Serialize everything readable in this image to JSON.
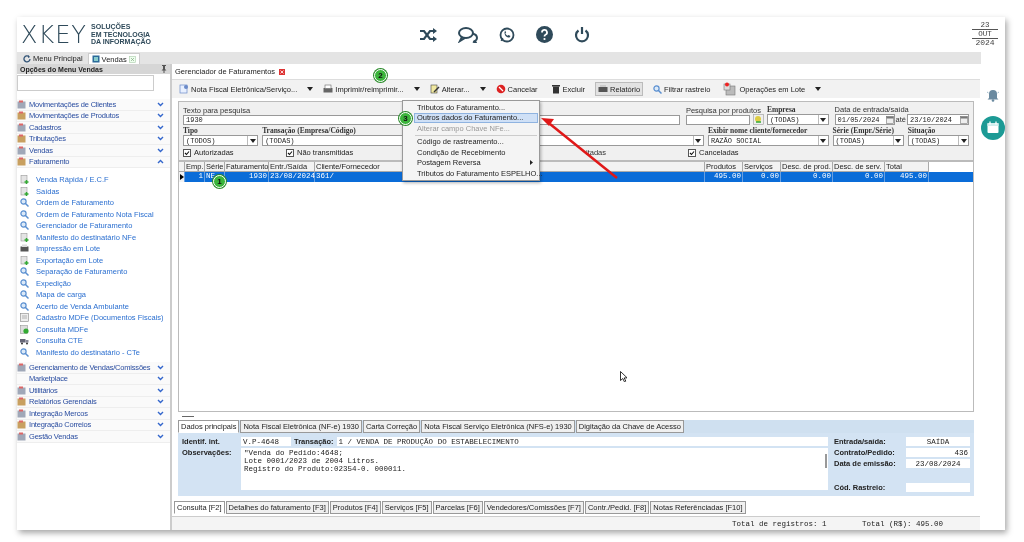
{
  "header": {
    "logo": "XKEY",
    "tagline": [
      "SOLUÇÕES",
      "EM TECNOLOGIA",
      "DA INFORMAÇÃO"
    ],
    "date": {
      "day": "23",
      "month": "OUT",
      "year": "2024"
    }
  },
  "top_tabs": [
    {
      "label": "Menu Principal",
      "selected": false
    },
    {
      "label": "Vendas",
      "selected": true
    }
  ],
  "sidebar": {
    "title": "Opções do Menu Vendas",
    "groups": [
      {
        "label": "Movimentações de Clientes",
        "kind": "icon",
        "expanded": false
      },
      {
        "label": "Movimentações de Produtos",
        "kind": "icon",
        "expanded": false
      },
      {
        "label": "Cadastros",
        "kind": "icon",
        "expanded": false
      },
      {
        "label": "Tributações",
        "kind": "icon",
        "expanded": false
      },
      {
        "label": "Vendas",
        "kind": "icon",
        "expanded": false
      },
      {
        "label": "Faturamento",
        "kind": "icon",
        "expanded": true,
        "children": [
          {
            "label": "Venda Rápida / E.C.F",
            "kind": "add"
          },
          {
            "label": "Saídas",
            "kind": "add"
          },
          {
            "label": "Ordem de Faturamento",
            "kind": "search"
          },
          {
            "label": "Ordem de Faturamento Nota Fiscal",
            "kind": "search"
          },
          {
            "label": "Gerenciador de Faturamento",
            "kind": "search"
          },
          {
            "label": "Manifesto do destinatário NFe",
            "kind": "add"
          },
          {
            "label": "Impressão em Lote",
            "kind": "print"
          },
          {
            "label": "Exportação em Lote",
            "kind": "add"
          },
          {
            "label": "Separação de Faturamento",
            "kind": "search"
          },
          {
            "label": "Expedição",
            "kind": "search"
          },
          {
            "label": "Mapa de carga",
            "kind": "search"
          },
          {
            "label": "Acerto de Venda Ambulante",
            "kind": "search"
          },
          {
            "label": "Cadastro MDFe (Documentos Fiscais)",
            "kind": "doc"
          },
          {
            "label": "Consulta MDFe",
            "kind": "globe"
          },
          {
            "label": "Consulta CTE",
            "kind": "truck"
          },
          {
            "label": "Manifesto do destinatário - CTe",
            "kind": "search"
          }
        ]
      },
      {
        "label": "Gerenciamento de Vendas/Comissões",
        "kind": "icon",
        "expanded": false
      },
      {
        "label": "Marketplace",
        "kind": "plain",
        "expanded": false
      },
      {
        "label": "Utilitários",
        "kind": "icon",
        "expanded": false
      },
      {
        "label": "Relatórios Gerenciais",
        "kind": "icon",
        "expanded": false
      },
      {
        "label": "Integração Mercos",
        "kind": "icon",
        "expanded": false
      },
      {
        "label": "Integração Correios",
        "kind": "icon",
        "expanded": false
      },
      {
        "label": "Gestão Vendas",
        "kind": "icon",
        "expanded": false
      }
    ]
  },
  "document_tab": {
    "label": "Gerenciador de Faturamentos"
  },
  "toolbar": [
    {
      "label": "Nota Fiscal Eletrônica/Serviço...",
      "kind": "nfe",
      "dropdown": true,
      "pressed": false
    },
    {
      "label": "Imprimir/reimprimir...",
      "kind": "print",
      "dropdown": true,
      "pressed": false
    },
    {
      "label": "Alterar...",
      "kind": "edit",
      "dropdown": true,
      "pressed": false
    },
    {
      "label": "Cancelar",
      "kind": "cancel",
      "dropdown": false,
      "pressed": false
    },
    {
      "label": "Excluir",
      "kind": "delete",
      "dropdown": false,
      "pressed": false
    },
    {
      "label": "Relatório",
      "kind": "report",
      "dropdown": false,
      "pressed": true
    },
    {
      "label": "Filtrar rastreio",
      "kind": "search",
      "dropdown": false,
      "pressed": false
    },
    {
      "label": "Operações em Lote",
      "kind": "batch",
      "dropdown": true,
      "pressed": false
    }
  ],
  "filters": {
    "search_label": "Texto para pesquisa",
    "search_value": "1930",
    "product_label": "Pesquisa por produtos",
    "empresa": {
      "label": "Empresa",
      "value": "(TODAS)"
    },
    "date_label": "Data de entrada/saída",
    "date_from": "01/05/2024",
    "date_sep": "até",
    "date_to": "23/10/2024",
    "tipo": {
      "label": "Tipo",
      "value": "(TODOS)"
    },
    "transacao": {
      "label": "Transação (Empresa/Código)",
      "value": "(TODAS)"
    },
    "exibir": {
      "label": "Exibir nome cliente/fornecedor",
      "value": "RAZÃO SOCIAL"
    },
    "serie": {
      "label": "Série (Empr./Série)",
      "value": "(TODAS)"
    },
    "situacao": {
      "label": "Situação",
      "value": "(TODAS)"
    },
    "checks": [
      {
        "label": "Autorizadas",
        "checked": true
      },
      {
        "label": "Não transmitidas",
        "checked": true
      }
    ],
    "partial_label": "itadas",
    "last_check": {
      "label": "Canceladas",
      "checked": true
    }
  },
  "table": {
    "columns": [
      "Emp.",
      "Série",
      "Faturamento",
      "Entr./Saída",
      "Cliente/Fornecedor",
      "Produtos",
      "Serviços",
      "Desc. de prod.",
      "Desc. de serv.",
      "Total"
    ],
    "rows": [
      {
        "selected": true,
        "cells": [
          "1",
          "NE",
          "1930",
          "23/08/2024",
          "361/",
          "495.00",
          "0.00",
          "0.00",
          "0.00",
          "495.00"
        ]
      }
    ]
  },
  "menu": [
    {
      "label": "Tributos do Faturamento...",
      "selected": false,
      "disabled": false,
      "submenu": false
    },
    {
      "label": "Outros dados do Faturamento...",
      "selected": true,
      "disabled": false,
      "submenu": false
    },
    {
      "label": "Alterar campo Chave NFe...",
      "selected": false,
      "disabled": true,
      "submenu": false
    },
    {
      "label": "Código de rastreamento...",
      "selected": false,
      "disabled": false,
      "submenu": false
    },
    {
      "label": "Condição de Recebimento",
      "selected": false,
      "disabled": false,
      "submenu": false
    },
    {
      "label": "Postagem Reversa",
      "selected": false,
      "disabled": false,
      "submenu": true
    },
    {
      "label": "Tributos do Faturamento ESPELHO...",
      "selected": false,
      "disabled": false,
      "submenu": false
    }
  ],
  "annotations": [
    "1",
    "2",
    "3"
  ],
  "detail_tabs": [
    {
      "label": "Dados principais",
      "selected": true
    },
    {
      "label": "Nota Fiscal Eletrônica (NF-e) 1930",
      "selected": false
    },
    {
      "label": "Carta Correção",
      "selected": false
    },
    {
      "label": "Nota Fiscal Serviço Eletrônica (NFS-e) 1930",
      "selected": false
    },
    {
      "label": "Digitação da Chave de Acesso",
      "selected": false
    }
  ],
  "details": {
    "ident_label": "Identif. int.",
    "ident": "V.P-4648",
    "transacao_label": "Transação:",
    "transacao": "1 / VENDA DE PRODUÇÃO DO ESTABELECIMENTO",
    "obs_label": "Observações:",
    "obs": [
      "\"Venda do Pedido:4648;",
      "Lote 0001/2023 de 2004 Litros.",
      "Registro do Produto:02354-0. 000011."
    ],
    "side": [
      {
        "label": "Entrada/saída:",
        "value": "SAÍDA"
      },
      {
        "label": "Contrato/Pedido:",
        "value": "436"
      },
      {
        "label": "Data de emissão:",
        "value": "23/08/2024"
      },
      {
        "label": "Cód. Rastreio:"
      }
    ]
  },
  "bottom_tabs": [
    {
      "label": "Consulta [F2]",
      "selected": true
    },
    {
      "label": "Detalhes do faturamento [F3]",
      "selected": false
    },
    {
      "label": "Produtos [F4]",
      "selected": false
    },
    {
      "label": "Serviços [F5]",
      "selected": false
    },
    {
      "label": "Parcelas [F6]",
      "selected": false
    },
    {
      "label": "Vendedores/Comissões [F7]",
      "selected": false
    },
    {
      "label": "Contr./Pedid. [F8]",
      "selected": false
    },
    {
      "label": "Notas Referênciadas [F10]",
      "selected": false
    }
  ],
  "status_bar": {
    "records": "Total de registros: 1",
    "total": "Total (R$): 495.00"
  }
}
